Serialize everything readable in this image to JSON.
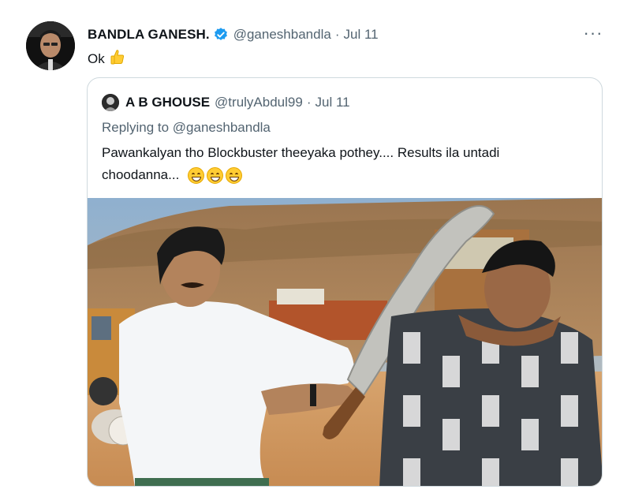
{
  "tweet": {
    "author_name": "BANDLA GANESH.",
    "author_handle": "@ganeshbandla",
    "separator": "·",
    "date": "Jul 11",
    "more_label": "···",
    "text": "Ok",
    "verified_color": "#1d9bf0"
  },
  "quoted": {
    "author_name": "A B GHOUSE",
    "author_handle": "@trulyAbdul99",
    "separator": "·",
    "date": "Jul 11",
    "replying_prefix": "Replying to",
    "replying_to": "@ganeshbandla",
    "text": "Pawankalyan tho Blockbuster theeyaka pothey.... Results ila untadi choodanna..."
  },
  "icons": {
    "verified": "verified-badge-icon",
    "more": "more-options-icon",
    "thumb": "thumbs-up-emoji",
    "grin": "grinning-squinting-face-emoji"
  }
}
